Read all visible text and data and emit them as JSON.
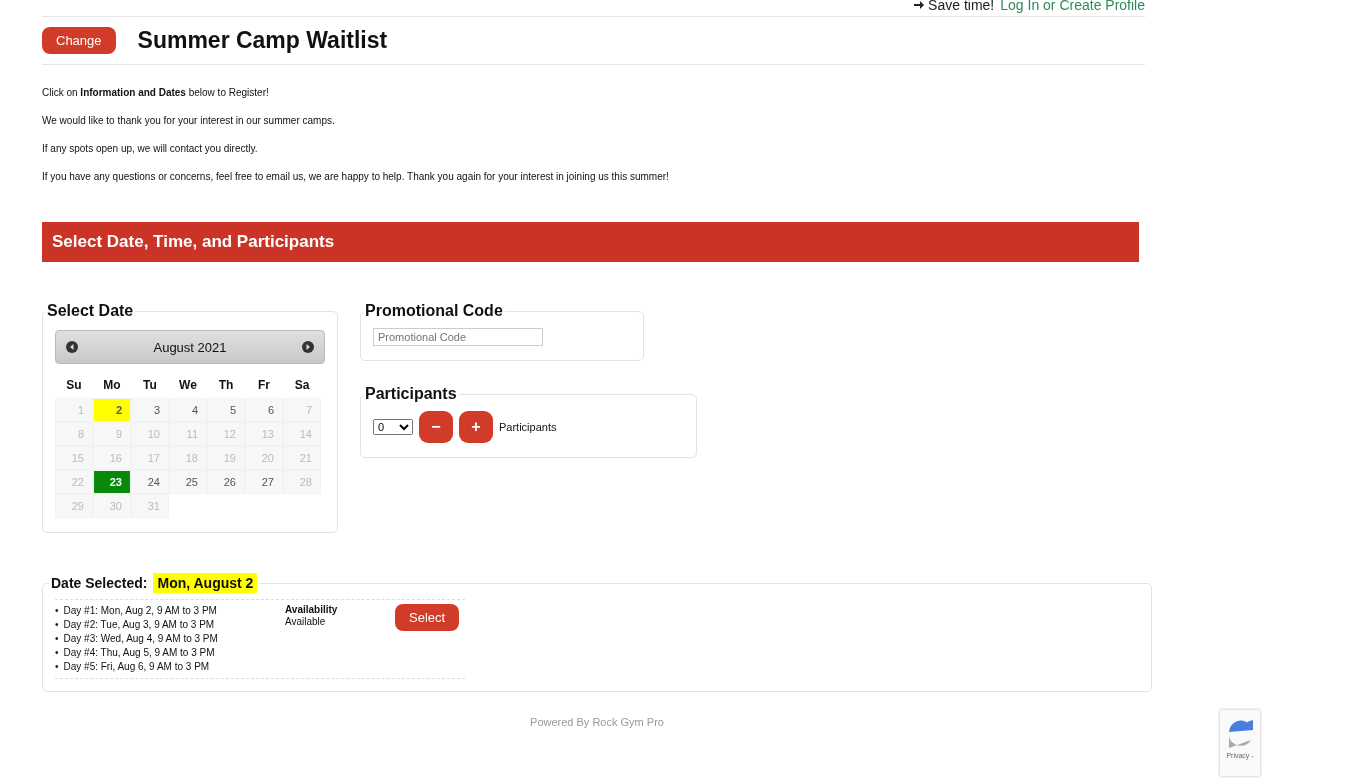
{
  "top_bar": {
    "save_text": "Save time!",
    "login_link": "Log In or Create Profile"
  },
  "header": {
    "change_button": "Change",
    "title": "Summer Camp Waitlist"
  },
  "intro": [
    "Click on **Information and Dates** below to Register!",
    "We would like to thank you for your interest in our summer camps.",
    "If any spots open up, we will contact you directly.",
    "If you have any questions or concerns, feel free to email us, we are happy to help. Thank you again for your interest in joining us this summer!"
  ],
  "section_title": "Select Date, Time, and Participants",
  "calendar": {
    "legend": "Select Date",
    "month": "August 2021",
    "weekdays": [
      "Su",
      "Mo",
      "Tu",
      "We",
      "Th",
      "Fr",
      "Sa"
    ],
    "days": [
      {
        "day": "1",
        "disabled": true,
        "selected": false,
        "today": false
      },
      {
        "day": "2",
        "disabled": false,
        "selected": true,
        "today": false
      },
      {
        "day": "3",
        "disabled": false,
        "selected": false,
        "today": false
      },
      {
        "day": "4",
        "disabled": false,
        "selected": false,
        "today": false
      },
      {
        "day": "5",
        "disabled": false,
        "selected": false,
        "today": false
      },
      {
        "day": "6",
        "disabled": false,
        "selected": false,
        "today": false
      },
      {
        "day": "7",
        "disabled": true,
        "selected": false,
        "today": false
      },
      {
        "day": "8",
        "disabled": true,
        "selected": false,
        "today": false
      },
      {
        "day": "9",
        "disabled": true,
        "selected": false,
        "today": false
      },
      {
        "day": "10",
        "disabled": true,
        "selected": false,
        "today": false
      },
      {
        "day": "11",
        "disabled": true,
        "selected": false,
        "today": false
      },
      {
        "day": "12",
        "disabled": true,
        "selected": false,
        "today": false
      },
      {
        "day": "13",
        "disabled": true,
        "selected": false,
        "today": false
      },
      {
        "day": "14",
        "disabled": true,
        "selected": false,
        "today": false
      },
      {
        "day": "15",
        "disabled": true,
        "selected": false,
        "today": false
      },
      {
        "day": "16",
        "disabled": true,
        "selected": false,
        "today": false
      },
      {
        "day": "17",
        "disabled": true,
        "selected": false,
        "today": false
      },
      {
        "day": "18",
        "disabled": true,
        "selected": false,
        "today": false
      },
      {
        "day": "19",
        "disabled": true,
        "selected": false,
        "today": false
      },
      {
        "day": "20",
        "disabled": true,
        "selected": false,
        "today": false
      },
      {
        "day": "21",
        "disabled": true,
        "selected": false,
        "today": false
      },
      {
        "day": "22",
        "disabled": true,
        "selected": false,
        "today": false
      },
      {
        "day": "23",
        "disabled": false,
        "selected": false,
        "today": true
      },
      {
        "day": "24",
        "disabled": false,
        "selected": false,
        "today": false
      },
      {
        "day": "25",
        "disabled": false,
        "selected": false,
        "today": false
      },
      {
        "day": "26",
        "disabled": false,
        "selected": false,
        "today": false
      },
      {
        "day": "27",
        "disabled": false,
        "selected": false,
        "today": false
      },
      {
        "day": "28",
        "disabled": true,
        "selected": false,
        "today": false
      },
      {
        "day": "29",
        "disabled": true,
        "selected": false,
        "today": false
      },
      {
        "day": "30",
        "disabled": true,
        "selected": false,
        "today": false
      },
      {
        "day": "31",
        "disabled": true,
        "selected": false,
        "today": false
      }
    ]
  },
  "promo": {
    "legend": "Promotional Code",
    "placeholder": "Promotional Code"
  },
  "participants": {
    "legend": "Participants",
    "count": "0",
    "label": "Participants",
    "minus": "−",
    "plus": "+"
  },
  "date_selected": {
    "label": "Date Selected:",
    "value": "Mon, August 2",
    "schedule": [
      {
        "bullet": "•",
        "text": "Day #1: Mon, Aug 2, 9 AM to 3 PM"
      },
      {
        "bullet": "•",
        "text": "Day #2: Tue, Aug 3, 9 AM to 3 PM"
      },
      {
        "bullet": "•",
        "text": "Day #3: Wed, Aug 4, 9 AM to 3 PM"
      },
      {
        "bullet": "•",
        "text": "Day #4: Thu, Aug 5, 9 AM to 3 PM"
      },
      {
        "bullet": "•",
        "text": "Day #5: Fri, Aug 6, 9 AM to 3 PM"
      }
    ],
    "availability_heading": "Availability",
    "availability": "Available",
    "select_button": "Select"
  },
  "footer": "Powered By Rock Gym Pro",
  "recaptcha": {
    "text": "Privacy -"
  }
}
